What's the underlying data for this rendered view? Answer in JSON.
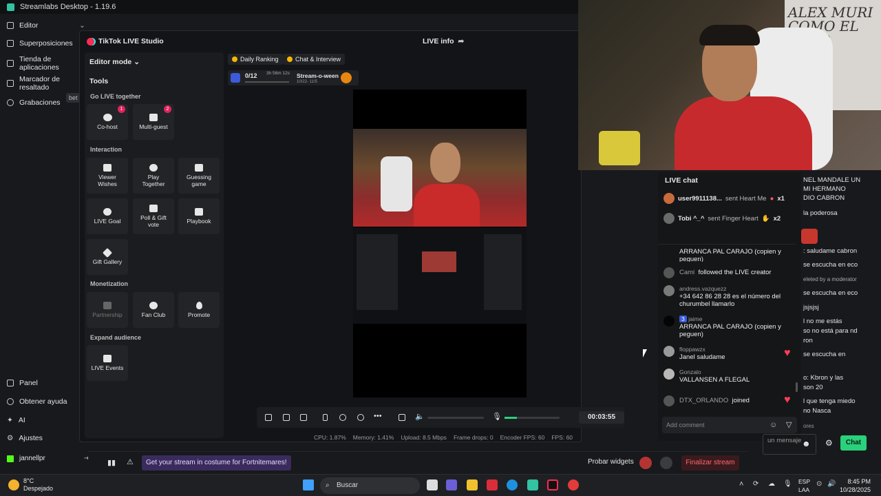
{
  "app": {
    "title": "Streamlabs Desktop - 1.19.6"
  },
  "sidebar": {
    "items": [
      {
        "label": "Editor"
      },
      {
        "label": "Superposiciones"
      },
      {
        "label": "Tienda de aplicaciones"
      },
      {
        "label": "Marcador de resaltado"
      },
      {
        "label": "Grabaciones"
      }
    ],
    "beta": "bet",
    "bottom_items": [
      {
        "label": "Panel"
      },
      {
        "label": "Obtener ayuda"
      },
      {
        "label": "AI"
      },
      {
        "label": "Ajustes"
      }
    ],
    "user": "jannellpr"
  },
  "studio": {
    "title": "TikTok LIVE Studio",
    "live_info": "LIVE info",
    "editor_mode": "Editor mode",
    "tools_title": "Tools",
    "sections": {
      "go_live": "Go LIVE together",
      "interaction": "Interaction",
      "monetization": "Monetization",
      "expand": "Expand audience"
    },
    "tiles": {
      "cohost": {
        "label": "Co-host",
        "badge": "1"
      },
      "multiguest": {
        "label": "Multi-guest",
        "badge": "2"
      },
      "viewer_wishes": "Viewer Wishes",
      "play_together": "Play Together",
      "guessing_game": "Guessing game",
      "live_goal": "LIVE Goal",
      "poll_gift_vote": "Poll & Gift vote",
      "playbook": "Playbook",
      "gift_gallery": "Gift Gallery",
      "partnership": "Partnership",
      "fan_club": "Fan Club",
      "promote": "Promote",
      "live_events": "LIVE Events"
    },
    "chips": {
      "daily_ranking": "Daily Ranking",
      "chat_interview": "Chat & Interview"
    },
    "ranking": {
      "progress": "0/12",
      "timer": "3h 56m 12s",
      "event": "Stream-o-ween",
      "dates": "10/22- 11/5"
    },
    "timer": "00:03:55",
    "stats": {
      "cpu": "CPU: 1.87%",
      "memory": "Memory: 1.41%",
      "upload": "Upload: 8.5 Mbps",
      "frame_drops": "Frame drops: 0",
      "encoder_fps": "Encoder FPS: 60",
      "fps": "FPS: 60"
    }
  },
  "webcam_text": "ALEX MURI COMO EL CULO",
  "live_chat": {
    "title": "LIVE chat",
    "gifts": [
      {
        "user": "user9911138...",
        "action": "sent Heart Me",
        "count": "x1"
      },
      {
        "user": "Tobi ^_^",
        "action": "sent Finger Heart",
        "count": "x2"
      }
    ],
    "partial": "ARRANCA PAL CARAJO (copien y peguen)",
    "messages": [
      {
        "name": "Cami",
        "text": "followed the LIVE creator",
        "inline": true
      },
      {
        "name": "andress.vazquezz",
        "text": "+34 642 86 28 28 es el número del churumbel llamarlo"
      },
      {
        "name": "jaime",
        "level": "3",
        "text": "ARRANCA PAL CARAJO (copien y peguen)"
      },
      {
        "name": "floppawzx",
        "text": "Janel saludame"
      },
      {
        "name": "Gonzalo",
        "text": "VALLANSEN A FLEGAL"
      },
      {
        "name": "DTX_ORLANDO",
        "text": "joined",
        "inline": true
      }
    ],
    "placeholder": "Add comment"
  },
  "sl_chat": [
    "NEL MANDALE UN",
    "MI HERMANO",
    "DIO CABRON",
    "la poderosa",
    ": saludame cabron",
    "se escucha en eco",
    "eleted by a moderator",
    "se escucha en eco",
    "jsjsjsj",
    "l no me estás",
    "so no está para nd",
    "ron",
    "se escucha en",
    "o: Kbron y las",
    "son 20",
    "l que tenga miedo",
    "no Nasca",
    "ores"
  ],
  "sl_bottom": {
    "banner": "Get your stream in costume for Fortnitemares!",
    "probar": "Probar widgets",
    "finalizar": "Finalizar stream",
    "mensaje": "un mensaje",
    "chat": "Chat"
  },
  "taskbar": {
    "temp": "8°C",
    "weather": "Despejado",
    "search": "Buscar",
    "lang1": "ESP",
    "lang2": "LAA",
    "time": "8:45 PM",
    "date": "10/28/2025"
  },
  "colors": {
    "accent": "#2ad17b",
    "tiktok": "#fe2c55",
    "danger": "#ff6b6b",
    "heart": "#ff3d57"
  }
}
